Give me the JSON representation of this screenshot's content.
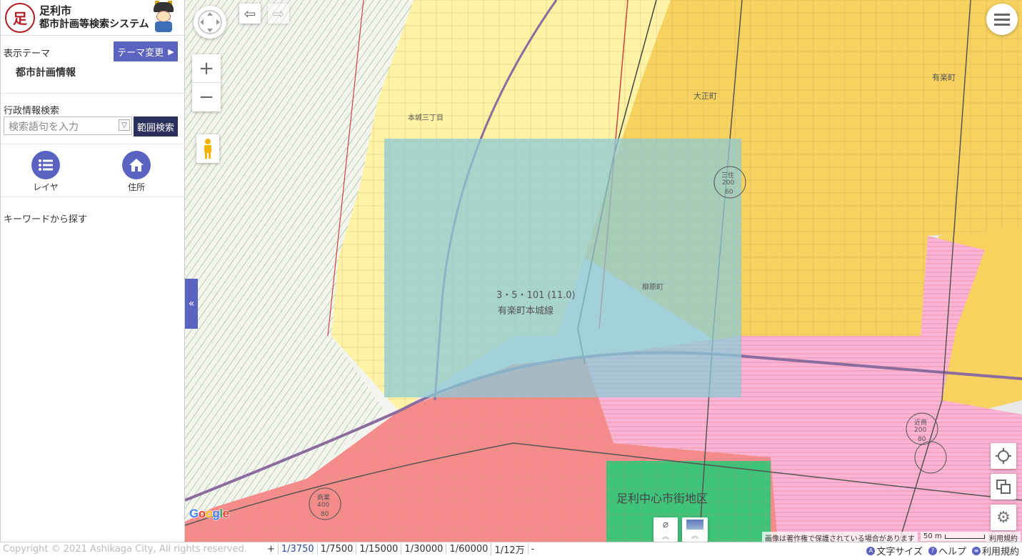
{
  "header": {
    "city": "足利市",
    "system_title": "都市計画等検索システム",
    "logo_glyph": "足"
  },
  "theme": {
    "label": "表示テーマ",
    "change_button": "テーマ変更",
    "current": "都市計画情報"
  },
  "search": {
    "label": "行政情報検索",
    "placeholder": "検索語句を入力",
    "button": "範囲検索"
  },
  "tools": [
    {
      "label": "レイヤ",
      "icon": "layer-list-icon"
    },
    {
      "label": "住所",
      "icon": "home-icon"
    }
  ],
  "keyword_search": "キーワードから探す",
  "map": {
    "labels": {
      "road_number": "3・5・101 (11.0)",
      "road_name": "有楽町本城線",
      "district": "足利中心市街地区",
      "town_yuraku": "有楽町",
      "town_taisho": "大正町",
      "town_honjo": "本城三丁目",
      "town_yanagihara": "柳原町",
      "zone_kinso": "近商",
      "zone_kinso_ratio_1": "200",
      "zone_kinso_ratio_2": "80",
      "zone_shogyo": "商業",
      "zone_shogyo_ratio_1": "400",
      "zone_shogyo_ratio_2": "80",
      "zone_sanju": "三住",
      "zone_sanju_ratio_1": "200",
      "zone_sanju_ratio_2": "60"
    },
    "attribution": "画像は著作権で保護されている場合があります",
    "scale_label": "50 m",
    "terms": "利用規約",
    "google": "Google"
  },
  "footer": {
    "copyright": "Copyright © 2021 Ashikaga City, All rights reserved.",
    "zoom_plus": "+",
    "scales": [
      "1/3750",
      "1/7500",
      "1/15000",
      "1/30000",
      "1/60000",
      "1/12万"
    ],
    "current_scale": "1/3750",
    "zoom_minus": "-",
    "font_size": "文字サイズ",
    "help": "ヘルプ",
    "terms": "利用規約"
  },
  "colors": {
    "accent": "#5b63c1",
    "dark_button": "#2b2f5c",
    "zone_yellow": "#fff3a6",
    "zone_orange": "#f7d25f",
    "zone_red": "#f58b8b",
    "zone_pink": "#f9b4d6",
    "zone_green": "#3ec47a",
    "selection": "#8cc9d6"
  }
}
